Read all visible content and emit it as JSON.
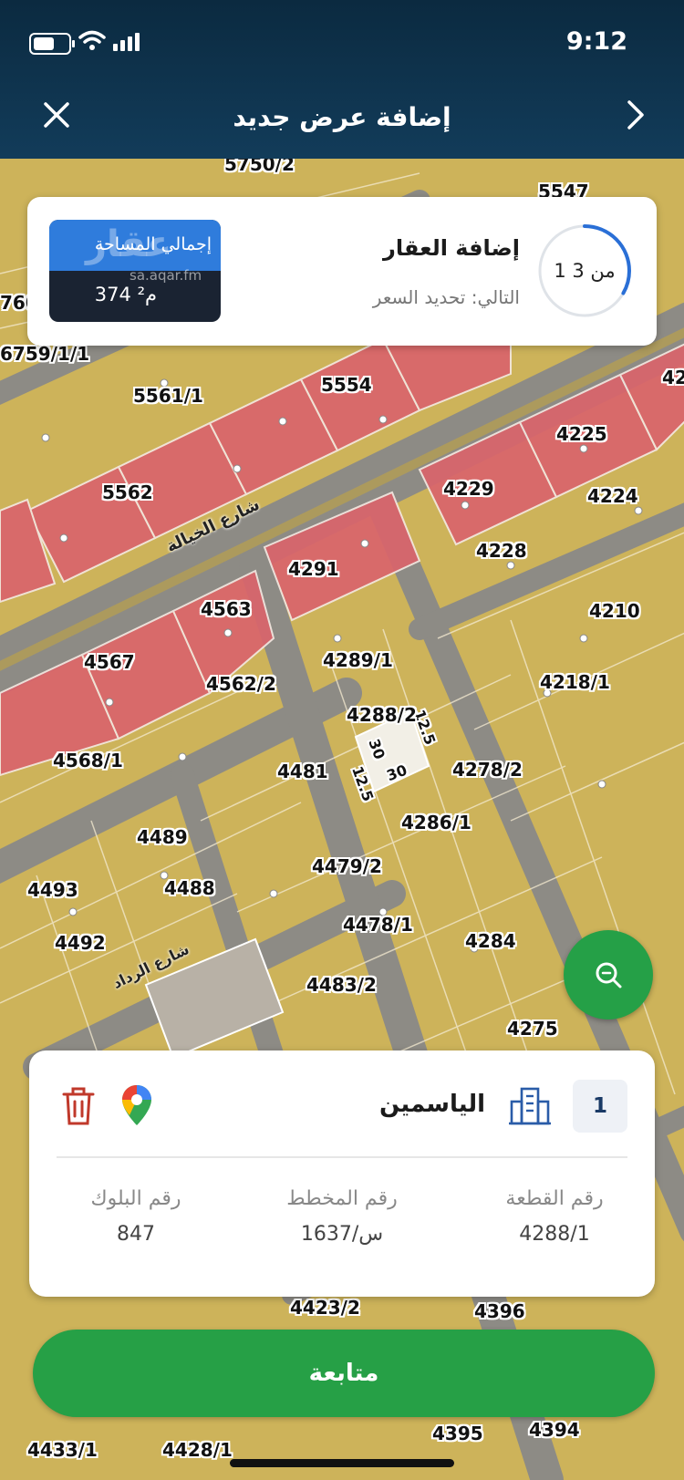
{
  "status_bar": {
    "time": "9:12"
  },
  "header": {
    "title": "إضافة عرض جديد",
    "close_icon": "close-icon",
    "next_icon": "chevron-right-icon"
  },
  "step_card": {
    "step_text": "1 من 3",
    "progress_fraction": 0.333,
    "title": "إضافة العقار",
    "next_step": "التالي: تحديد السعر",
    "area_label": "إجمالي المساحة",
    "area_value": "374 م²",
    "watermark": "عقار",
    "watermark_url": "sa.aqar.fm"
  },
  "map": {
    "street_labels": [
      "شارع الخيالة",
      "شارع الرداد"
    ],
    "dimension_labels": [
      "30",
      "30",
      "12.5",
      "12.5"
    ],
    "plot_labels": [
      "5750/2",
      "5561/1",
      "5554",
      "5562",
      "4225",
      "4229",
      "4224",
      "4228",
      "4291",
      "4210",
      "4563",
      "4567",
      "4289/1",
      "4218/1",
      "4562/2",
      "4288/2",
      "4568/1",
      "4481",
      "4278/2",
      "4286/1",
      "4489",
      "4479/2",
      "4493",
      "4488",
      "4478/1",
      "4492",
      "4284",
      "4483/2",
      "4275",
      "4423/2",
      "4396",
      "4395",
      "4394",
      "4433/1",
      "4428/1",
      "5547",
      "760",
      "6759/1/1",
      "42"
    ],
    "colors": {
      "yellow": "#d8bc5c",
      "red": "#d9646c",
      "road": "#8b8b8b"
    }
  },
  "zoom_button": {
    "icon": "search-zoom-icon",
    "color": "#25a047"
  },
  "property": {
    "index": "1",
    "name": "الياسمين",
    "building_icon": "building-icon",
    "maps_icon": "google-maps-icon",
    "delete_icon": "trash-icon",
    "fields": [
      {
        "label": "رقم القطعة",
        "value": "4288/1"
      },
      {
        "label": "رقم المخطط",
        "value": "1637/س"
      },
      {
        "label": "رقم البلوك",
        "value": "847"
      }
    ]
  },
  "continue_button": {
    "label": "متابعة",
    "color": "#26a046"
  }
}
